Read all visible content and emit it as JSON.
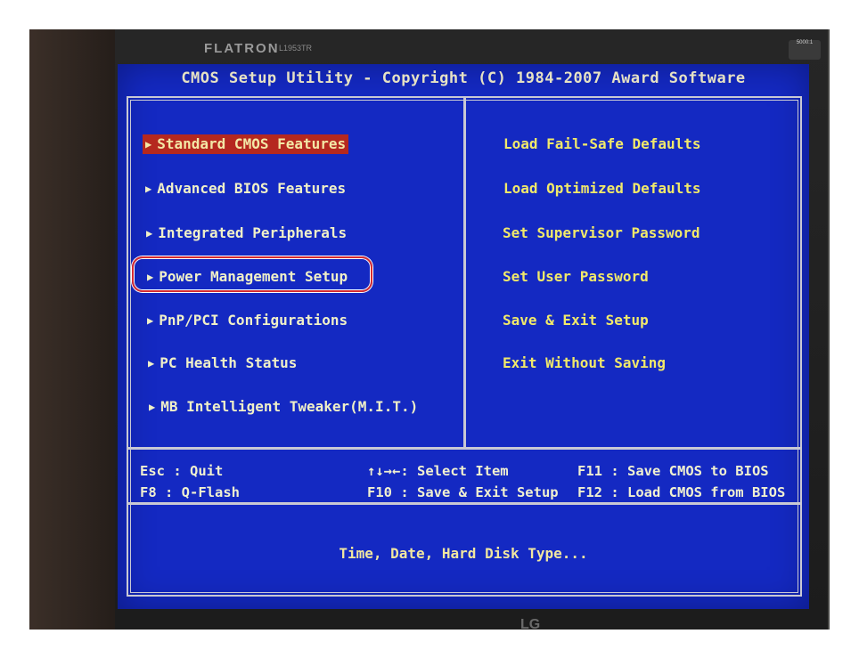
{
  "monitor": {
    "brand": "FLATRON",
    "model": "L1953TR",
    "badge": "5000:1",
    "bottom_logo": "LG"
  },
  "bios": {
    "title": "CMOS Setup Utility - Copyright (C) 1984-2007 Award Software",
    "left_menu": [
      {
        "label": "Standard CMOS Features",
        "selected": true
      },
      {
        "label": "Advanced BIOS Features",
        "selected": false
      },
      {
        "label": "Integrated Peripherals",
        "selected": false
      },
      {
        "label": "Power Management Setup",
        "selected": false,
        "highlighted": true
      },
      {
        "label": "PnP/PCI Configurations",
        "selected": false
      },
      {
        "label": "PC Health Status",
        "selected": false
      },
      {
        "label": "MB Intelligent Tweaker(M.I.T.)",
        "selected": false
      }
    ],
    "right_menu": [
      "Load Fail-Safe Defaults",
      "Load Optimized Defaults",
      "Set Supervisor Password",
      "Set User Password",
      "Save & Exit Setup",
      "Exit Without Saving"
    ],
    "help": {
      "esc": "Esc  : Quit",
      "f8": "F8   : Q-Flash",
      "select": "↑↓→←: Select Item",
      "f10": "F10  : Save & Exit Setup",
      "f11": "F11  : Save CMOS to BIOS",
      "f12": "F12  : Load CMOS from BIOS"
    },
    "description": "Time, Date, Hard Disk Type...",
    "arrow_glyph": "▶",
    "colors": {
      "screen_bg": "#1429c2",
      "selected_bg": "#b5281f",
      "right_text": "#f1e96a",
      "annotation_circle": "#d52b32"
    }
  }
}
